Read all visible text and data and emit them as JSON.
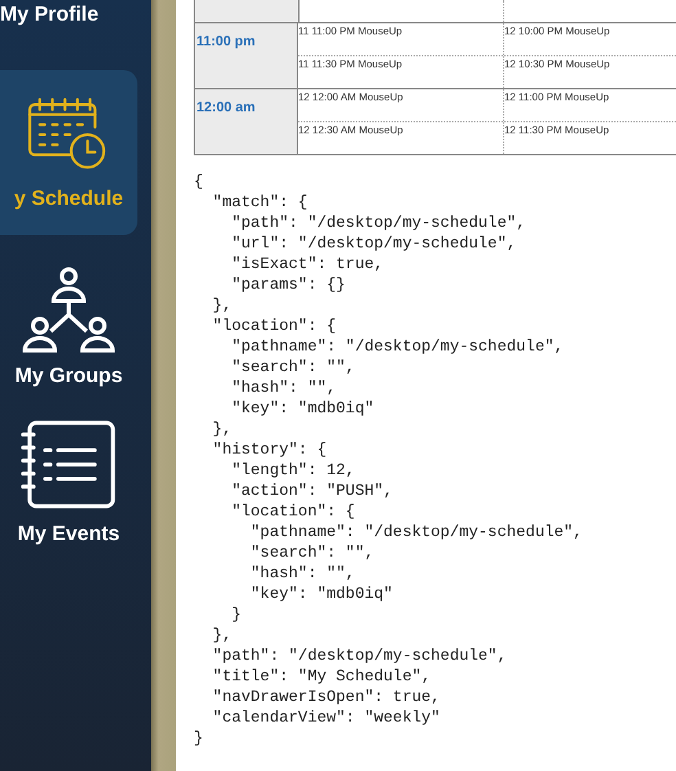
{
  "sidebar": {
    "items": [
      {
        "label": "My Profile",
        "selected": false,
        "kind": "none"
      },
      {
        "label": "y Schedule",
        "selected": true,
        "kind": "calendar"
      },
      {
        "label": "My Groups",
        "selected": false,
        "kind": "groups"
      },
      {
        "label": "My Events",
        "selected": false,
        "kind": "notebook"
      }
    ]
  },
  "calendar": {
    "hours": [
      {
        "time": "11:00 pm",
        "slots": [
          [
            "11 11:00 PM MouseUp",
            "12 10:00 PM MouseUp"
          ],
          [
            "11 11:30 PM MouseUp",
            "12 10:30 PM MouseUp"
          ]
        ]
      },
      {
        "time": "12:00 am",
        "slots": [
          [
            "12 12:00 AM MouseUp",
            "12 11:00 PM MouseUp"
          ],
          [
            "12 12:30 AM MouseUp",
            "12 11:30 PM MouseUp"
          ]
        ]
      }
    ]
  },
  "debug_output": {
    "lines": [
      "{",
      "  \"match\": {",
      "    \"path\": \"/desktop/my-schedule\",",
      "    \"url\": \"/desktop/my-schedule\",",
      "    \"isExact\": true,",
      "    \"params\": {}",
      "  },",
      "  \"location\": {",
      "    \"pathname\": \"/desktop/my-schedule\",",
      "    \"search\": \"\",",
      "    \"hash\": \"\",",
      "    \"key\": \"mdb0iq\"",
      "  },",
      "  \"history\": {",
      "    \"length\": 12,",
      "    \"action\": \"PUSH\",",
      "    \"location\": {",
      "      \"pathname\": \"/desktop/my-schedule\",",
      "      \"search\": \"\",",
      "      \"hash\": \"\",",
      "      \"key\": \"mdb0iq\"",
      "    }",
      "  },",
      "  \"path\": \"/desktop/my-schedule\",",
      "  \"title\": \"My Schedule\",",
      "  \"navDrawerIsOpen\": true,",
      "  \"calendarView\": \"weekly\"",
      "}"
    ]
  }
}
